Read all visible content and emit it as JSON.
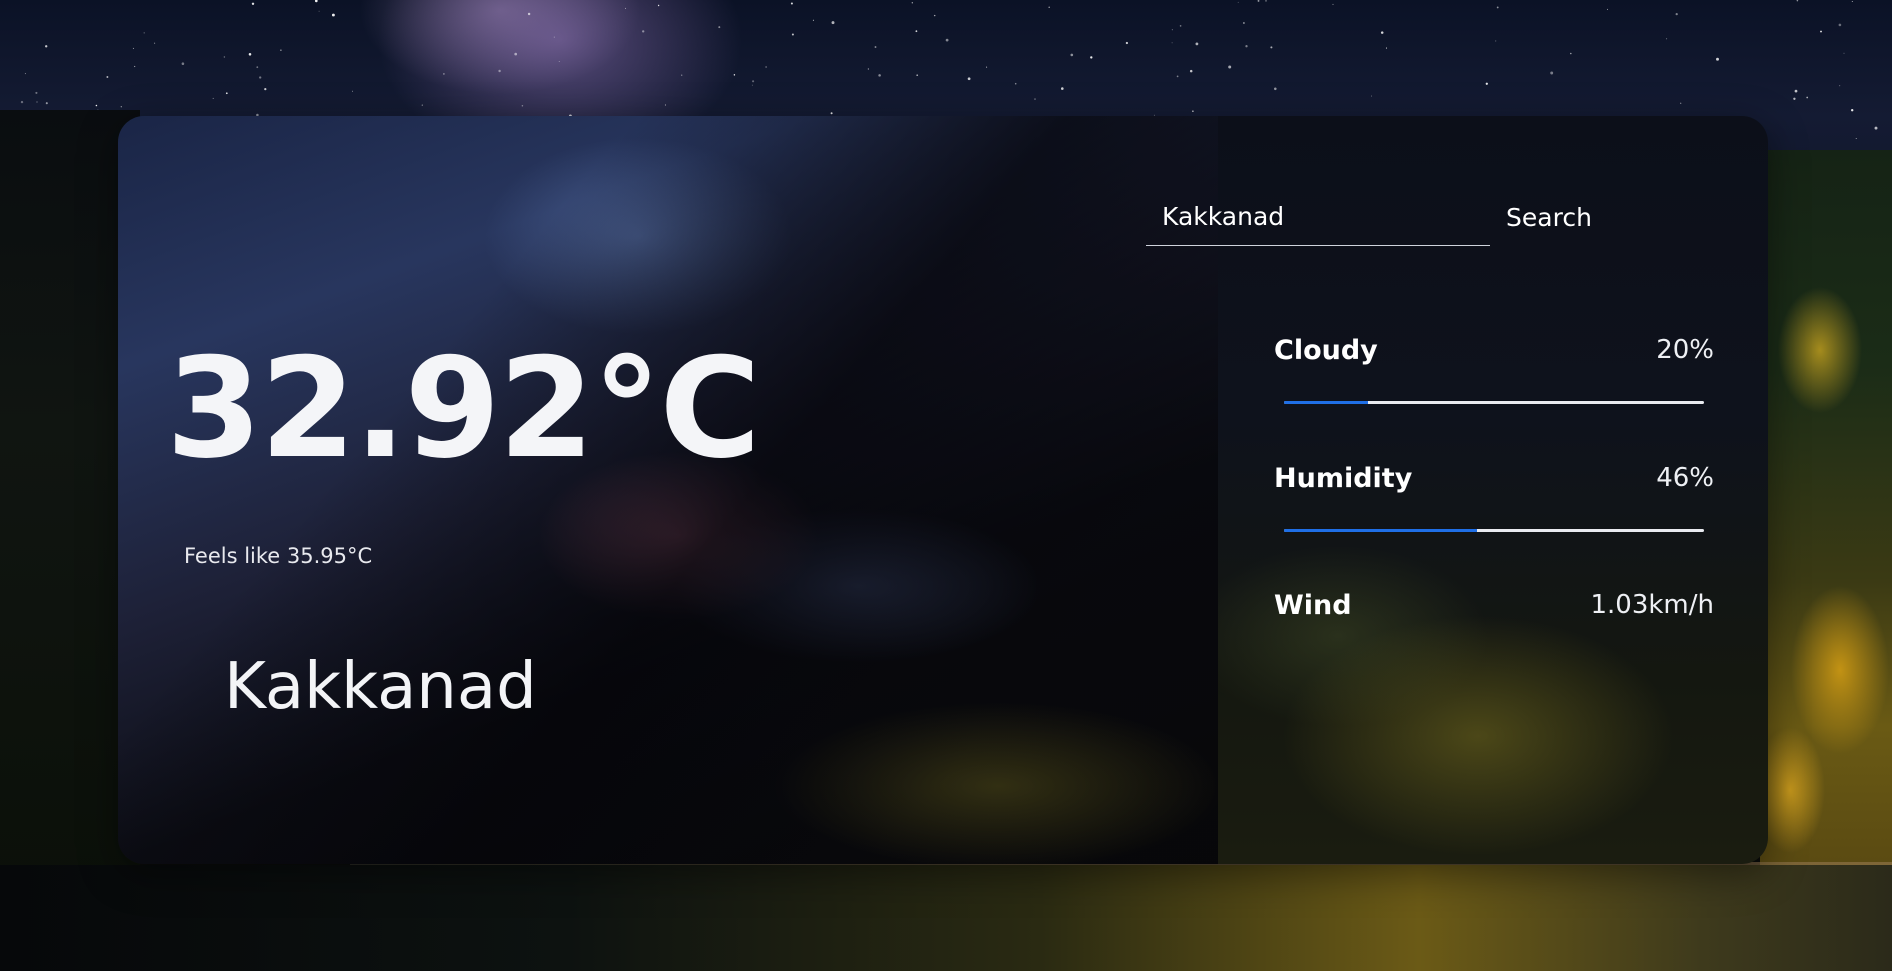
{
  "weather": {
    "temperature": "32.92°C",
    "feels_like": "Feels like 35.95°C",
    "city": "Kakkanad"
  },
  "search": {
    "value": "Kakkanad",
    "placeholder": "",
    "button_label": "Search"
  },
  "stats": [
    {
      "label": "Cloudy",
      "value": "20%",
      "bar_fraction": 0.2
    },
    {
      "label": "Humidity",
      "value": "46%",
      "bar_fraction": 0.46
    },
    {
      "label": "Wind",
      "value": "1.03km/h"
    }
  ],
  "colors": {
    "accent": "#1f6fe6",
    "bar_track": "#e9ebf0",
    "text": "#ffffff"
  }
}
